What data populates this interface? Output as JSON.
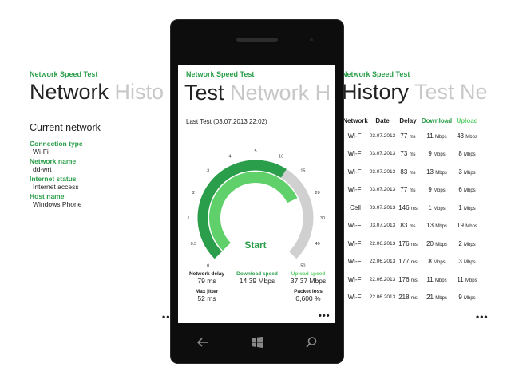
{
  "left_panel": {
    "app_title": "Network Speed Test",
    "header_active": "Network",
    "header_next": "Histo",
    "section_title": "Current network",
    "fields": [
      {
        "key": "Connection type",
        "value": "Wi-Fi"
      },
      {
        "key": "Network name",
        "value": "dd-wrt"
      },
      {
        "key": "Internet status",
        "value": "Internet access"
      },
      {
        "key": "Host name",
        "value": "Windows Phone"
      }
    ],
    "more": "•••"
  },
  "phone": {
    "app_title": "Network Speed Test",
    "header_active": "Test",
    "header_next": "Network H",
    "last_test": "Last Test (03.07.2013 22:02)",
    "gauge": {
      "start_label": "Start",
      "scale_labels": [
        "0",
        "0.5",
        "1",
        "2",
        "3",
        "4",
        "5",
        "10",
        "15",
        "20",
        "30",
        "40",
        "50"
      ],
      "download_level": 0.62,
      "upload_level": 0.74
    },
    "stats": {
      "network_delay_label": "Network delay",
      "network_delay_value": "79 ms",
      "download_label": "Download speed",
      "download_value": "14,39 Mbps",
      "upload_label": "Upload speed",
      "upload_value": "37,37 Mbps",
      "jitter_label": "Max jitter",
      "jitter_value": "52 ms",
      "loss_label": "Packet loss",
      "loss_value": "0,600 %"
    },
    "more": "•••",
    "nav": {
      "back": "back-icon",
      "home": "windows-icon",
      "search": "search-icon"
    }
  },
  "right_panel": {
    "app_title": "Network Speed Test",
    "header_active": "History",
    "header_next": "Test Ne",
    "columns": [
      "Network",
      "Date",
      "Delay",
      "Download",
      "Upload"
    ],
    "rows": [
      {
        "network": "Wi-Fi",
        "date": "03.07.2013",
        "delay": "77",
        "delay_unit": "ms",
        "download": "11",
        "download_unit": "Mbps",
        "upload": "43",
        "upload_unit": "Mbps"
      },
      {
        "network": "Wi-Fi",
        "date": "03.07.2013",
        "delay": "73",
        "delay_unit": "ms",
        "download": "9",
        "download_unit": "Mbps",
        "upload": "8",
        "upload_unit": "Mbps"
      },
      {
        "network": "Wi-Fi",
        "date": "03.07.2013",
        "delay": "83",
        "delay_unit": "ms",
        "download": "13",
        "download_unit": "Mbps",
        "upload": "3",
        "upload_unit": "Mbps"
      },
      {
        "network": "Wi-Fi",
        "date": "03.07.2013",
        "delay": "77",
        "delay_unit": "ms",
        "download": "9",
        "download_unit": "Mbps",
        "upload": "6",
        "upload_unit": "Mbps"
      },
      {
        "network": "Cell",
        "date": "03.07.2013",
        "delay": "146",
        "delay_unit": "ms",
        "download": "1",
        "download_unit": "Mbps",
        "upload": "1",
        "upload_unit": "Mbps"
      },
      {
        "network": "Wi-Fi",
        "date": "03.07.2013",
        "delay": "83",
        "delay_unit": "ms",
        "download": "13",
        "download_unit": "Mbps",
        "upload": "19",
        "upload_unit": "Mbps"
      },
      {
        "network": "Wi-Fi",
        "date": "22.06.2013",
        "delay": "176",
        "delay_unit": "ms",
        "download": "20",
        "download_unit": "Mbps",
        "upload": "2",
        "upload_unit": "Mbps"
      },
      {
        "network": "Wi-Fi",
        "date": "22.06.2013",
        "delay": "177",
        "delay_unit": "ms",
        "download": "8",
        "download_unit": "Mbps",
        "upload": "3",
        "upload_unit": "Mbps"
      },
      {
        "network": "Wi-Fi",
        "date": "22.06.2013",
        "delay": "176",
        "delay_unit": "ms",
        "download": "11",
        "download_unit": "Mbps",
        "upload": "11",
        "upload_unit": "Mbps"
      },
      {
        "network": "Wi-Fi",
        "date": "22.06.2013",
        "delay": "218",
        "delay_unit": "ms",
        "download": "21",
        "download_unit": "Mbps",
        "upload": "9",
        "upload_unit": "Mbps"
      }
    ],
    "more": "•••"
  },
  "colors": {
    "accent": "#2a9e4a",
    "accent_light": "#5fd06a",
    "gauge_track": "#d0d0d0"
  }
}
